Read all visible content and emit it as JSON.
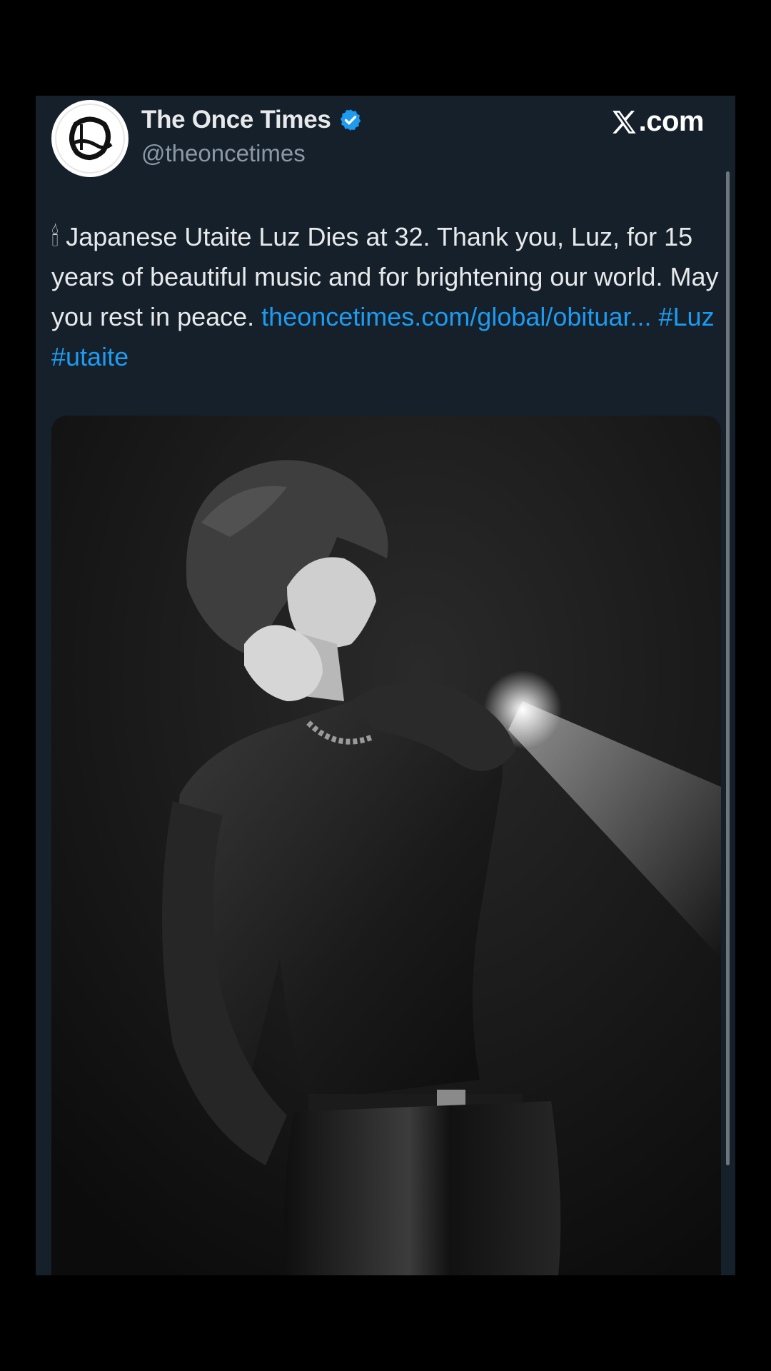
{
  "account": {
    "display_name": "The Once Times",
    "handle": "@theoncetimes",
    "verified": true,
    "avatar_letter": "O"
  },
  "brand": {
    "label": ".com",
    "icon": "x-logo-icon"
  },
  "tweet": {
    "emoji": "🕯",
    "text": " Japanese Utaite Luz Dies at 32. Thank you, Luz, for 15 years of beautiful music and for brightening our world. May you rest in peace. ",
    "link": "theoncetimes.com/global/obituar...",
    "hashtags": [
      "#Luz",
      "#utaite"
    ]
  },
  "media": {
    "description_icon": "concert-photo-image"
  },
  "colors": {
    "background": "#000000",
    "card": "#15202b",
    "text": "#e7e9ea",
    "secondary_text": "#8b98a5",
    "link": "#1d9bf0",
    "verified": "#1d9bf0"
  }
}
